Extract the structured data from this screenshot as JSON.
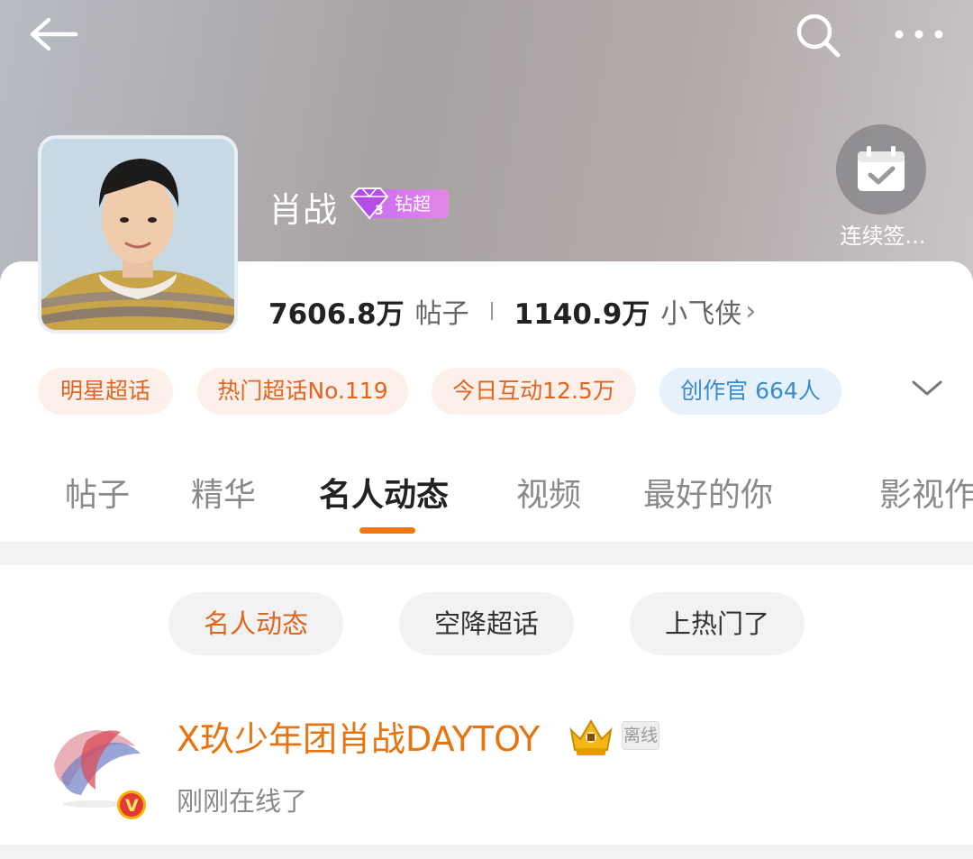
{
  "header": {
    "back_icon": "arrow-left-icon",
    "search_icon": "search-icon",
    "more_icon": "more-dots-icon",
    "checkin_icon": "calendar-check-icon",
    "checkin_label": "连续签..."
  },
  "profile": {
    "name": "肖战",
    "badge_text": "钻超",
    "badge_level": "3",
    "stats": [
      {
        "value": "7606.8万",
        "label": "帖子"
      },
      {
        "value": "1140.9万",
        "label": "小飞侠"
      }
    ],
    "stats_arrow": "›"
  },
  "tags": [
    "明星超话",
    "热门超话No.119",
    "今日互动12.5万",
    "创作官 664人"
  ],
  "tabs": [
    "帖子",
    "精华",
    "名人动态",
    "视频",
    "最好的你",
    "影视作"
  ],
  "active_tab": "名人动态",
  "filters": [
    "名人动态",
    "空降超话",
    "上热门了"
  ],
  "active_filter": "名人动态",
  "feed_item": {
    "name": "X玖少年团肖战DAYTOY",
    "status_badge": "离线",
    "subtitle": "刚刚在线了",
    "verified_mark": "V"
  },
  "colors": {
    "accent_orange": "#f5780a",
    "name_orange": "#e8740f",
    "tag_blue": "#3b8bd1",
    "badge_purple": "#b24de8"
  }
}
